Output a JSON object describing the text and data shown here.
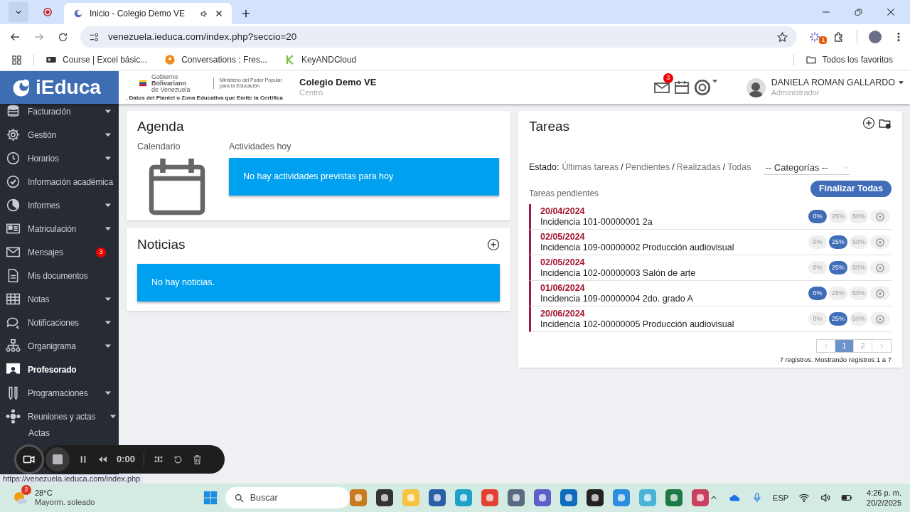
{
  "browser": {
    "tabs": [
      {
        "title": "Inicio - Colegio Demo VE",
        "selected": true
      }
    ],
    "address": "venezuela.ieduca.com/index.php?seccio=20",
    "extension_badge": "1",
    "bookmarks": [
      "Course | Excel básic...",
      "Conversations : Fres...",
      "KeyANDCloud"
    ],
    "all_bookmarks": "Todos los favoritos"
  },
  "header": {
    "logo_text": "iEduca",
    "gov_name": "Gobierno **Bolivariano**",
    "gov_country": "de Venezuela",
    "gov_ministry": "Ministerio del Poder Popular para la Educación",
    "gov_caption": ". Datos del Plantel o Zona Educativa que Emite la Certifica",
    "school": "Colegio Demo VE",
    "school_role": "Centro",
    "mail_badge": "3",
    "user_name": "DANIELA ROMAN GALLARDO",
    "user_role": "Administrador"
  },
  "sidebar": {
    "items": [
      {
        "label": "Facturación",
        "expandable": true,
        "selected": false
      },
      {
        "label": "Gestión",
        "expandable": true,
        "selected": false
      },
      {
        "label": "Horarios",
        "expandable": true,
        "selected": false
      },
      {
        "label": "Información académica",
        "expandable": false,
        "selected": false
      },
      {
        "label": "Informes",
        "expandable": true,
        "selected": false
      },
      {
        "label": "Matriculación",
        "expandable": true,
        "selected": false
      },
      {
        "label": "Mensajes",
        "expandable": false,
        "selected": false,
        "badge": "3"
      },
      {
        "label": "Mis documentos",
        "expandable": false,
        "selected": false
      },
      {
        "label": "Notas",
        "expandable": true,
        "selected": false
      },
      {
        "label": "Notificaciones",
        "expandable": true,
        "selected": false
      },
      {
        "label": "Organigrama",
        "expandable": true,
        "selected": false
      },
      {
        "label": "Profesorado",
        "expandable": false,
        "selected": true
      },
      {
        "label": "Programaciones",
        "expandable": true,
        "selected": false
      },
      {
        "label": "Reuniones y actas",
        "expandable": true,
        "selected": false
      }
    ],
    "subitems": [
      "Actas"
    ]
  },
  "agenda": {
    "title": "Agenda",
    "calendar_label": "Calendario",
    "activities_label": "Actividades hoy",
    "activities_empty": "No hay actividades previstas para hoy"
  },
  "news": {
    "title": "Noticias",
    "empty": "No hay noticias."
  },
  "tasks": {
    "title": "Tareas",
    "status_label": "Estado:",
    "filters": [
      "Últimas tareas",
      "Pendientes",
      "Realizadas",
      "Todas"
    ],
    "filter_separator": "/",
    "category_placeholder": "-- Categorías --",
    "finalize_button": "Finalizar Todas",
    "section_label": "Tareas pendientes",
    "items": [
      {
        "date": "20/04/2024",
        "name": "Incidencia 101-00000001 2a",
        "progress": [
          {
            "label": "0%",
            "selected": true
          },
          {
            "label": "25%",
            "selected": false
          },
          {
            "label": "50%",
            "selected": false
          }
        ]
      },
      {
        "date": "02/05/2024",
        "name": "Incidencia 109-00000002 Producción audiovisual",
        "progress": [
          {
            "label": "0%",
            "selected": false
          },
          {
            "label": "25%",
            "selected": true
          },
          {
            "label": "50%",
            "selected": false
          }
        ]
      },
      {
        "date": "02/05/2024",
        "name": "Incidencia 102-00000003 Salón de arte",
        "progress": [
          {
            "label": "0%",
            "selected": false
          },
          {
            "label": "25%",
            "selected": true
          },
          {
            "label": "50%",
            "selected": false
          }
        ]
      },
      {
        "date": "01/06/2024",
        "name": "Incidencia 109-00000004 2do. grado A",
        "progress": [
          {
            "label": "0%",
            "selected": true
          },
          {
            "label": "25%",
            "selected": false
          },
          {
            "label": "50%",
            "selected": false
          }
        ]
      },
      {
        "date": "20/06/2024",
        "name": "Incidencia 102-00000005 Producción audiovisual",
        "progress": [
          {
            "label": "0%",
            "selected": false
          },
          {
            "label": "25%",
            "selected": true
          },
          {
            "label": "50%",
            "selected": false
          }
        ]
      }
    ],
    "pages": [
      {
        "label": "1",
        "selected": true
      },
      {
        "label": "2",
        "selected": false
      }
    ],
    "summary": "7 registros. Mostrando registros 1 a 7"
  },
  "recorder": {
    "time": "0:00"
  },
  "status_url": "https://venezuela.ieduca.com/index.php",
  "taskbar": {
    "weather_badge": "2",
    "temperature": "28°C",
    "condition": "Mayorm. soleado",
    "search_placeholder": "Buscar",
    "language": "ESP",
    "time": "4:26 p. m.",
    "date": "20/2/2025"
  }
}
